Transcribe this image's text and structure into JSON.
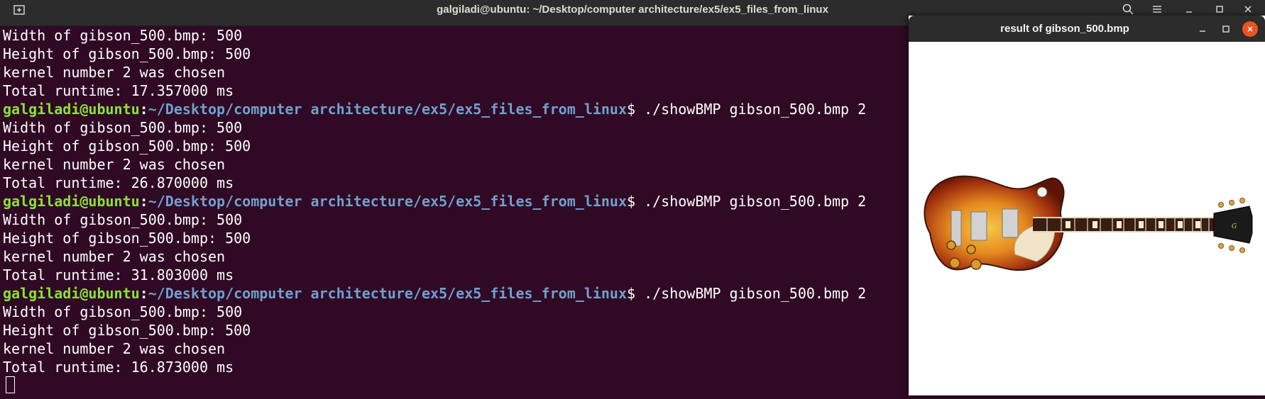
{
  "window": {
    "title": "galgiladi@ubuntu: ~/Desktop/computer architecture/ex5/ex5_files_from_linux",
    "buttons": [
      "new-tab-icon",
      "search-icon",
      "menu-icon",
      "minimize-icon",
      "maximize-icon",
      "close-icon"
    ]
  },
  "terminal": {
    "prompt": {
      "user": "galgiladi@ubuntu",
      "colon": ":",
      "path": "~/Desktop/computer architecture/ex5/ex5_files_from_linux",
      "dollar": "$ ",
      "command": "./showBMP gibson_500.bmp 2"
    },
    "lines": [
      {
        "type": "out",
        "text": "Width of gibson_500.bmp: 500"
      },
      {
        "type": "out",
        "text": "Height of gibson_500.bmp: 500"
      },
      {
        "type": "out",
        "text": "kernel number 2 was chosen"
      },
      {
        "type": "out",
        "text": "Total runtime: 17.357000 ms"
      },
      {
        "type": "prompt"
      },
      {
        "type": "out",
        "text": "Width of gibson_500.bmp: 500"
      },
      {
        "type": "out",
        "text": "Height of gibson_500.bmp: 500"
      },
      {
        "type": "out",
        "text": "kernel number 2 was chosen"
      },
      {
        "type": "out",
        "text": "Total runtime: 26.870000 ms"
      },
      {
        "type": "prompt"
      },
      {
        "type": "out",
        "text": "Width of gibson_500.bmp: 500"
      },
      {
        "type": "out",
        "text": "Height of gibson_500.bmp: 500"
      },
      {
        "type": "out",
        "text": "kernel number 2 was chosen"
      },
      {
        "type": "out",
        "text": "Total runtime: 31.803000 ms"
      },
      {
        "type": "prompt"
      },
      {
        "type": "out",
        "text": "Width of gibson_500.bmp: 500"
      },
      {
        "type": "out",
        "text": "Height of gibson_500.bmp: 500"
      },
      {
        "type": "out",
        "text": "kernel number 2 was chosen"
      },
      {
        "type": "out",
        "text": "Total runtime: 16.873000 ms"
      },
      {
        "type": "cursor"
      }
    ]
  },
  "viewer": {
    "title": "result of gibson_500.bmp",
    "image_subject": "gibson les paul guitar (sunburst)",
    "buttons": [
      "minimize-icon",
      "maximize-icon",
      "close-icon"
    ]
  },
  "colors": {
    "terminal_bg": "#300a24",
    "prompt_user": "#8ae234",
    "prompt_path": "#729fcf",
    "titlebar": "#2c2c2c",
    "close_button": "#e95420"
  }
}
